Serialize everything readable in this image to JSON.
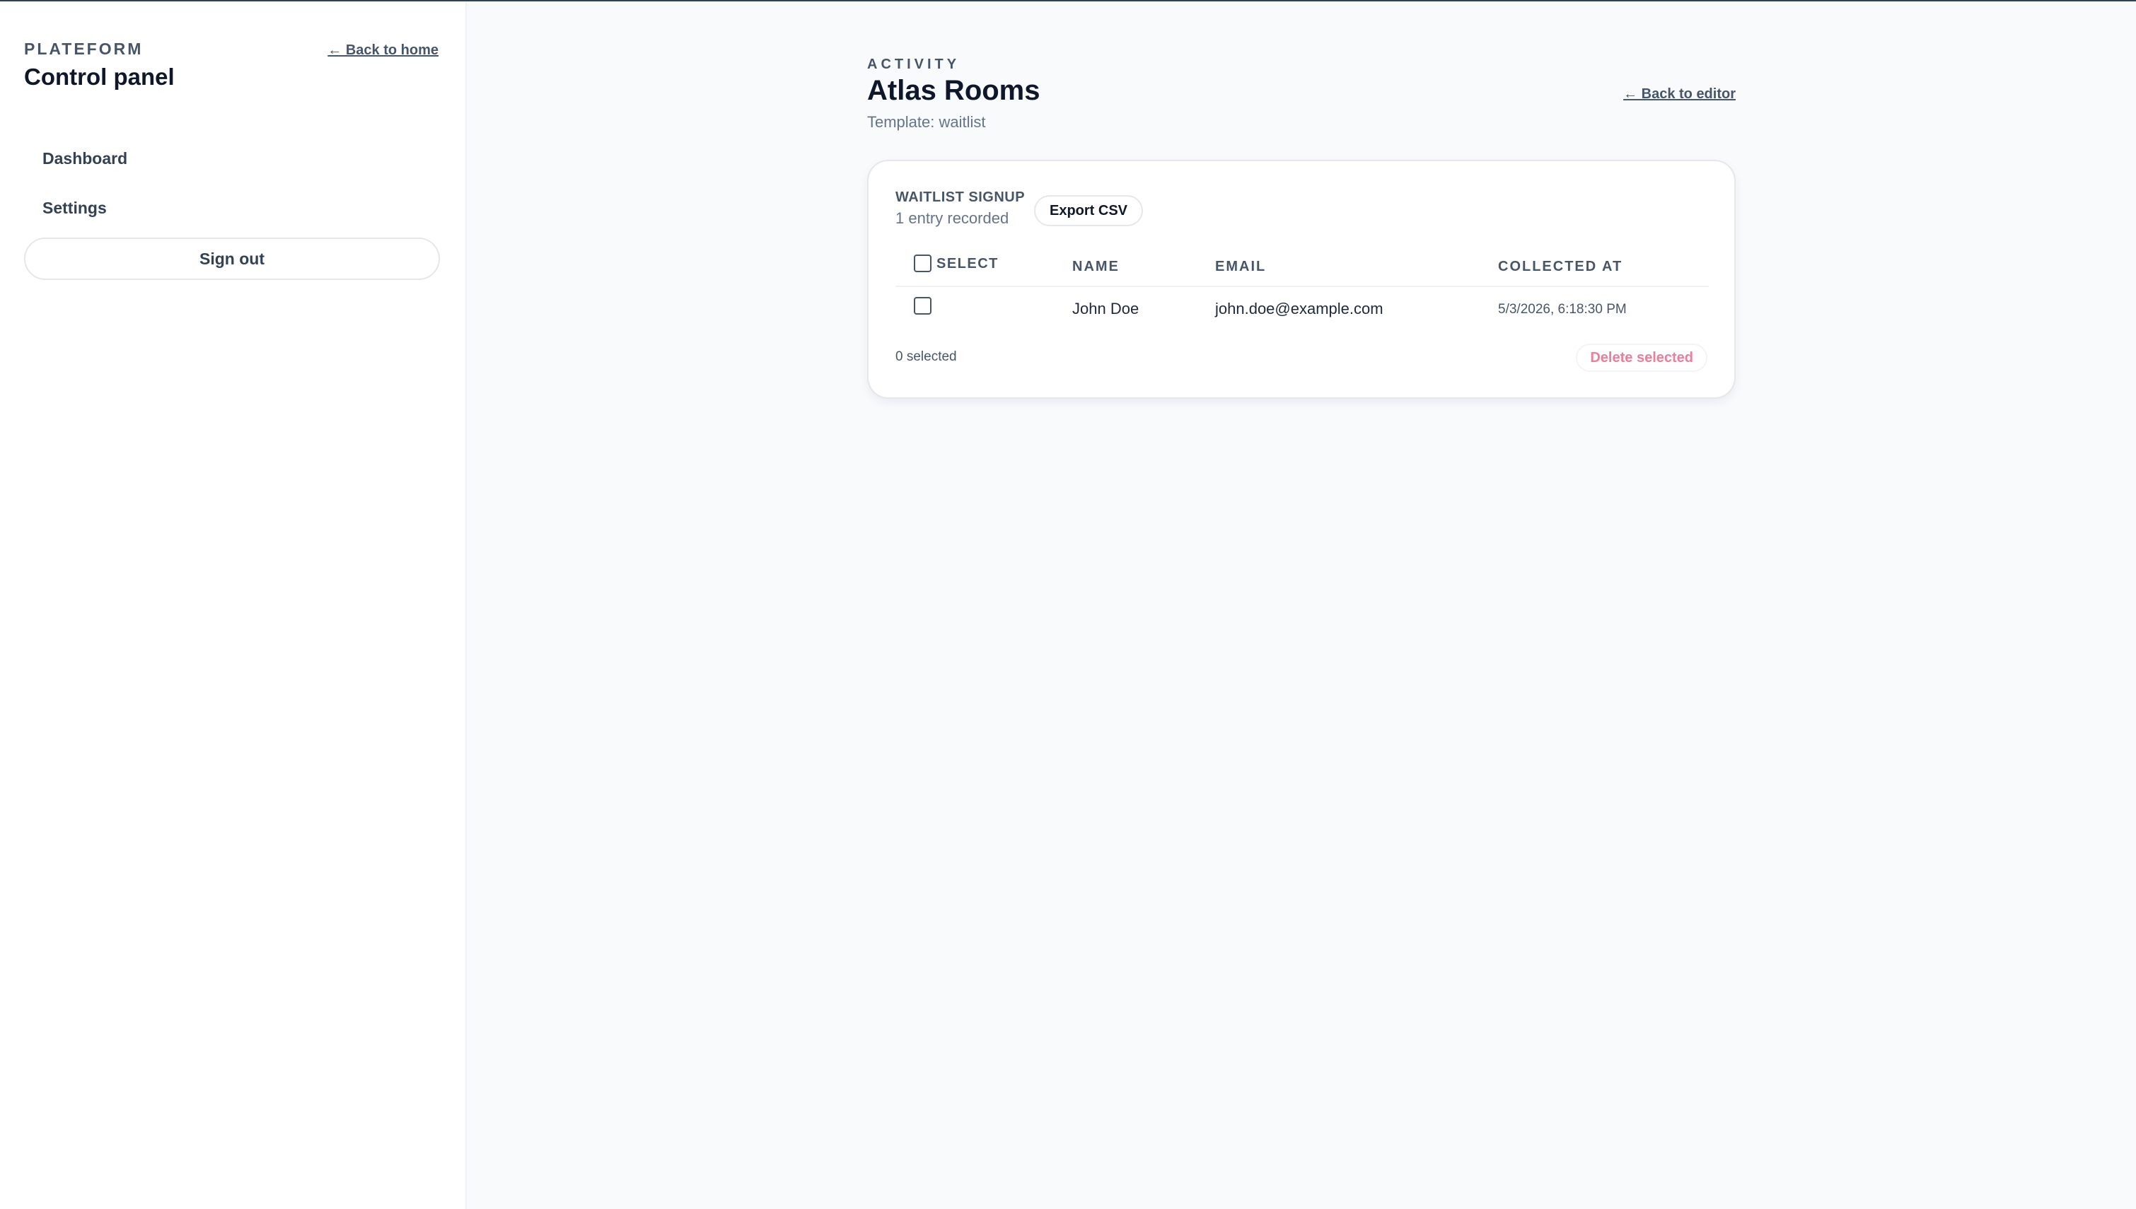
{
  "sidebar": {
    "brand": "PLATEFORM",
    "title": "Control panel",
    "back_home": "← Back to home",
    "nav": [
      {
        "label": "Dashboard"
      },
      {
        "label": "Settings"
      }
    ],
    "sign_out": "Sign out"
  },
  "header": {
    "eyebrow": "ACTIVITY",
    "title": "Atlas Rooms",
    "template": "Template: waitlist",
    "back_editor": "← Back to editor"
  },
  "card": {
    "label": "WAITLIST SIGNUP",
    "count": "1 entry recorded",
    "export_label": "Export CSV",
    "columns": {
      "select": "SELECT",
      "name": "NAME",
      "email": "EMAIL",
      "collected": "COLLECTED AT"
    },
    "rows": [
      {
        "name": "John Doe",
        "email": "john.doe@example.com",
        "collected_at": "5/3/2026, 6:18:30 PM",
        "checked": false
      }
    ],
    "selected_count": "0 selected",
    "delete_label": "Delete selected"
  },
  "colors": {
    "background": "#f8fafc",
    "sidebar": "#ffffff",
    "text_primary": "#0f172a",
    "text_muted": "#475569",
    "danger": "#e87f9c"
  }
}
